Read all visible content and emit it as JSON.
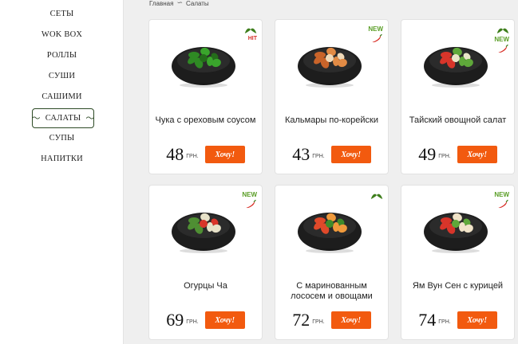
{
  "sidebar": {
    "items": [
      {
        "label": "СЕТЫ"
      },
      {
        "label": "WOK BOX"
      },
      {
        "label": "РОЛЛЫ"
      },
      {
        "label": "СУШИ"
      },
      {
        "label": "САШИМИ"
      },
      {
        "label": "САЛАТЫ",
        "active": true
      },
      {
        "label": "СУПЫ"
      },
      {
        "label": "НАПИТКИ"
      }
    ]
  },
  "breadcrumb": {
    "home": "Главная",
    "current": "Салаты"
  },
  "currency": "ГРН.",
  "order_label": "Хочу!",
  "badge_new_label": "NEW",
  "badge_hit_label": "HIT",
  "colors": {
    "accent": "#f25a0f",
    "new": "#5a9e26",
    "hit": "#d6312c",
    "active_border": "#2d4a25"
  },
  "products": [
    {
      "name": "Чука с ореховым соусом",
      "price": "48",
      "badges": [
        "leaf",
        "hit"
      ]
    },
    {
      "name": "Кальмары по-корейски",
      "price": "43",
      "badges": [
        "new",
        "pepper"
      ]
    },
    {
      "name": "Тайский овощной салат",
      "price": "49",
      "badges": [
        "leaf",
        "new",
        "pepper"
      ]
    },
    {
      "name": "Огурцы Ча",
      "price": "69",
      "badges": [
        "new",
        "pepper"
      ]
    },
    {
      "name": "С маринованным лососем и овощами",
      "price": "72",
      "badges": [
        "leaf"
      ]
    },
    {
      "name": "Ям Вун Сен с курицей",
      "price": "74",
      "badges": [
        "new",
        "pepper"
      ]
    }
  ]
}
